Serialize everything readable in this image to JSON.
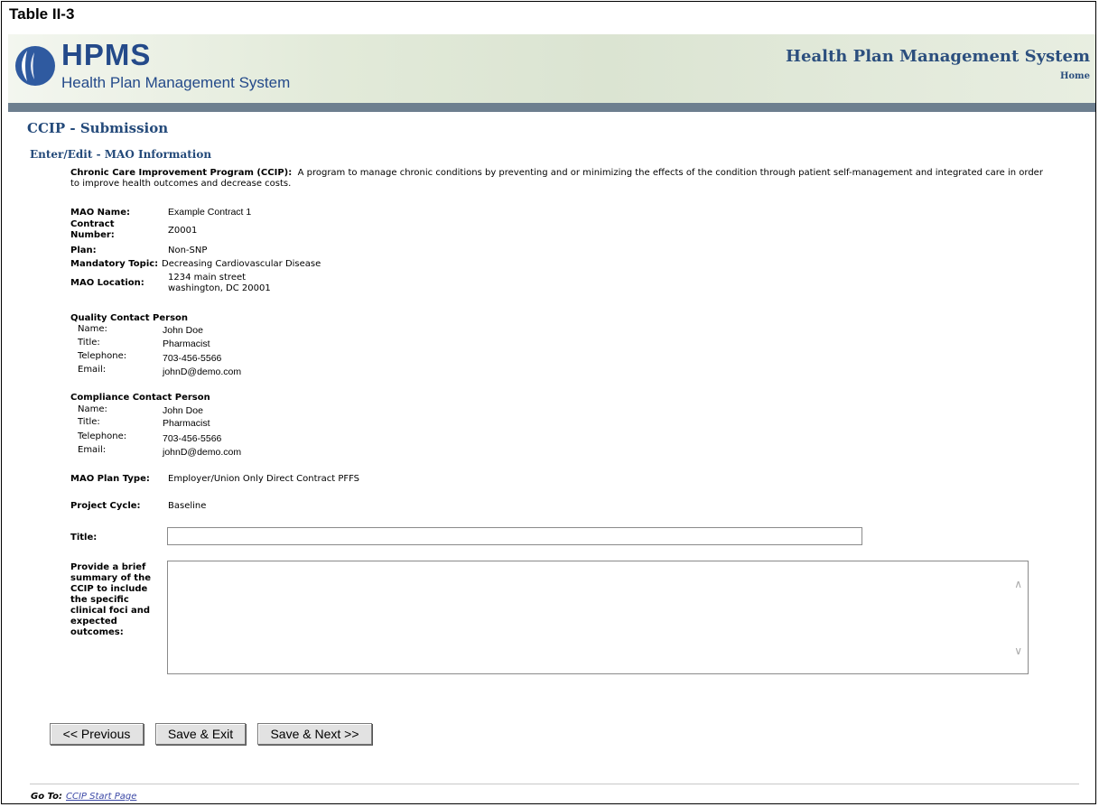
{
  "table_label": "Table II-3",
  "header": {
    "logo_text": "HPMS",
    "logo_subtext": "Health Plan Management System",
    "system_title": "Health Plan Management System",
    "home_link": "Home"
  },
  "page_title": "CCIP - Submission",
  "section_title": "Enter/Edit - MAO Information",
  "intro": {
    "term": "Chronic Care Improvement Program (CCIP):",
    "definition": "A program to manage chronic conditions by preventing and or minimizing the effects of the condition through patient self-management and integrated care in order to improve health outcomes and decrease costs."
  },
  "mao": {
    "name_label": "MAO Name:",
    "name_value": "Example Contract 1",
    "contract_label_1": "Contract",
    "contract_label_2": "Number:",
    "contract_value": "Z0001",
    "plan_label": "Plan:",
    "plan_value": "Non-SNP",
    "topic_label": "Mandatory Topic:",
    "topic_value": "Decreasing Cardiovascular Disease",
    "location_label": "MAO Location:",
    "location_line1": "1234 main street",
    "location_line2": "washington, DC 20001"
  },
  "quality_contact": {
    "heading": "Quality Contact Person",
    "name_label": "Name:",
    "name_value": "John Doe",
    "title_label": "Title:",
    "title_value": "Pharmacist",
    "phone_label": "Telephone:",
    "phone_value": "703-456-5566",
    "email_label": "Email:",
    "email_value": "johnD@demo.com"
  },
  "compliance_contact": {
    "heading": "Compliance Contact Person",
    "name_label": "Name:",
    "name_value": "John Doe",
    "title_label": "Title:",
    "title_value": "Pharmacist",
    "phone_label": "Telephone:",
    "phone_value": "703-456-5566",
    "email_label": "Email:",
    "email_value": "johnD@demo.com"
  },
  "plan_type": {
    "label": "MAO Plan Type:",
    "value": "Employer/Union Only Direct Contract PFFS"
  },
  "project_cycle": {
    "label": "Project Cycle:",
    "value": "Baseline"
  },
  "form": {
    "title_label": "Title:",
    "title_value": "",
    "summary_label_lines": [
      "Provide a brief",
      "summary of the",
      "CCIP to include",
      "the specific",
      "clinical foci and",
      "expected",
      "outcomes:"
    ],
    "summary_value": ""
  },
  "buttons": {
    "previous": "<< Previous",
    "save_exit": "Save & Exit",
    "save_next": "Save & Next >>"
  },
  "footer": {
    "goto_label": "Go To:",
    "goto_link": "CCIP Start Page"
  }
}
